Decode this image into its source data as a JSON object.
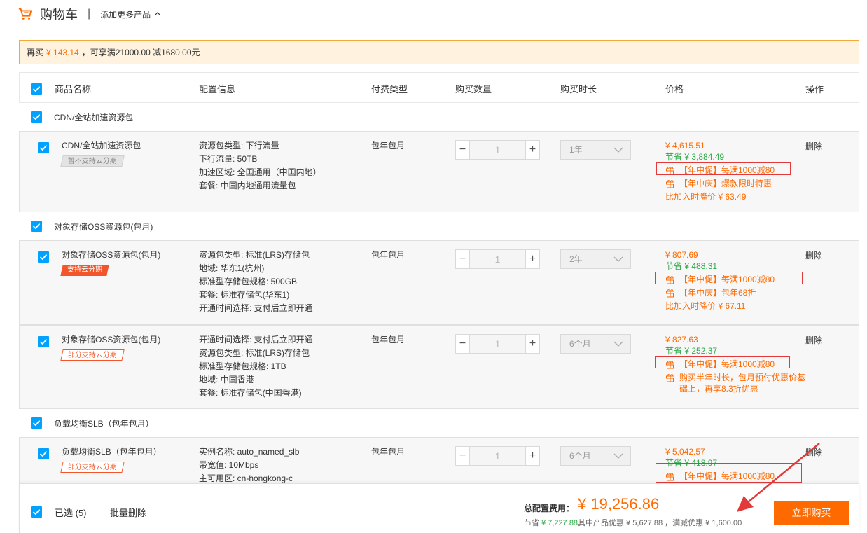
{
  "header": {
    "title": "购物车",
    "separator": "|",
    "add_more": "添加更多产品",
    "icons": {
      "cart": "cart-icon",
      "add_more": "chevron-up-icon"
    }
  },
  "notice": {
    "prefix": "再买",
    "amount": "¥ 143.14",
    "suffix": "，可享满21000.00 减1680.00元"
  },
  "table": {
    "columns": [
      "商品名称",
      "配置信息",
      "付费类型",
      "购买数量",
      "购买时长",
      "价格",
      "操作"
    ]
  },
  "groups": [
    {
      "label": "CDN/全站加速资源包",
      "items": [
        {
          "name": "CDN/全站加速资源包",
          "tag": "暂不支持云分期",
          "config": [
            "资源包类型: 下行流量",
            "下行流量: 50TB",
            "加速区域: 全国通用（中国内地）",
            "套餐: 中国内地通用流量包"
          ],
          "pay_type": "包年包月",
          "quantity": "1",
          "duration": "1年",
          "price": "¥ 4,615.51",
          "save": "节省 ¥ 3,884.49",
          "promos": [
            "【年中促】每满1000减80",
            "【年中庆】爆款限时特惠"
          ],
          "drop": "比加入时降价 ¥ 63.49",
          "op": "删除"
        }
      ]
    },
    {
      "label": "对象存储OSS资源包(包月)",
      "items": [
        {
          "name": "对象存储OSS资源包(包月)",
          "tag": "支持云分期",
          "config": [
            "资源包类型: 标准(LRS)存储包",
            "地域: 华东1(杭州)",
            "标准型存储包规格: 500GB",
            "套餐: 标准存储包(华东1)",
            "开通时间选择: 支付后立即开通"
          ],
          "pay_type": "包年包月",
          "quantity": "1",
          "duration": "2年",
          "price": "¥ 807.69",
          "save": "节省 ¥ 488.31",
          "promos": [
            "【年中促】每满1000减80",
            "【年中庆】包年68折"
          ],
          "drop": "比加入时降价 ¥ 67.11",
          "op": "删除"
        },
        {
          "name": "对象存储OSS资源包(包月)",
          "tag": "部分支持云分期",
          "config": [
            "开通时间选择: 支付后立即开通",
            "资源包类型: 标准(LRS)存储包",
            "标准型存储包规格: 1TB",
            "地域: 中国香港",
            "套餐: 标准存储包(中国香港)"
          ],
          "pay_type": "包年包月",
          "quantity": "1",
          "duration": "6个月",
          "price": "¥ 827.63",
          "save": "节省 ¥ 252.37",
          "promos": [
            "【年中促】每满1000减80",
            "购买半年时长，包月预付优惠价基",
            "础上，再享8.3折优惠"
          ],
          "op": "删除"
        }
      ]
    },
    {
      "label": "负载均衡SLB（包年包月）",
      "items": [
        {
          "name": "负载均衡SLB（包年包月）",
          "tag": "部分支持云分期",
          "config": [
            "实例名称: auto_named_slb",
            "带宽值: 10Mbps",
            "主可用区: cn-hongkong-c"
          ],
          "pay_type": "包年包月",
          "quantity": "1",
          "duration": "6个月",
          "price": "¥ 5,042.57",
          "save": "节省 ¥ 418.97",
          "promos": [
            "【年中促】每满1000减80"
          ],
          "op": "删除"
        }
      ]
    }
  ],
  "stepper": {
    "minus": "−",
    "plus": "+"
  },
  "footer": {
    "selected": "已选 (5)",
    "batch_delete": "批量删除",
    "total_label": "总配置费用：",
    "total": "¥ 19,256.86",
    "save_prefix": "节省",
    "save_amount": "¥ 7,227.88",
    "save_rest": "其中产品优惠 ¥ 5,627.88 ，满减优惠 ¥ 1,600.00",
    "buy": "立即购买"
  },
  "colors": {
    "accent_orange": "#ff6a00",
    "checkbox_blue": "#00a2ff",
    "save_green": "#2fa94a",
    "annotation_red": "#e23a3a"
  }
}
